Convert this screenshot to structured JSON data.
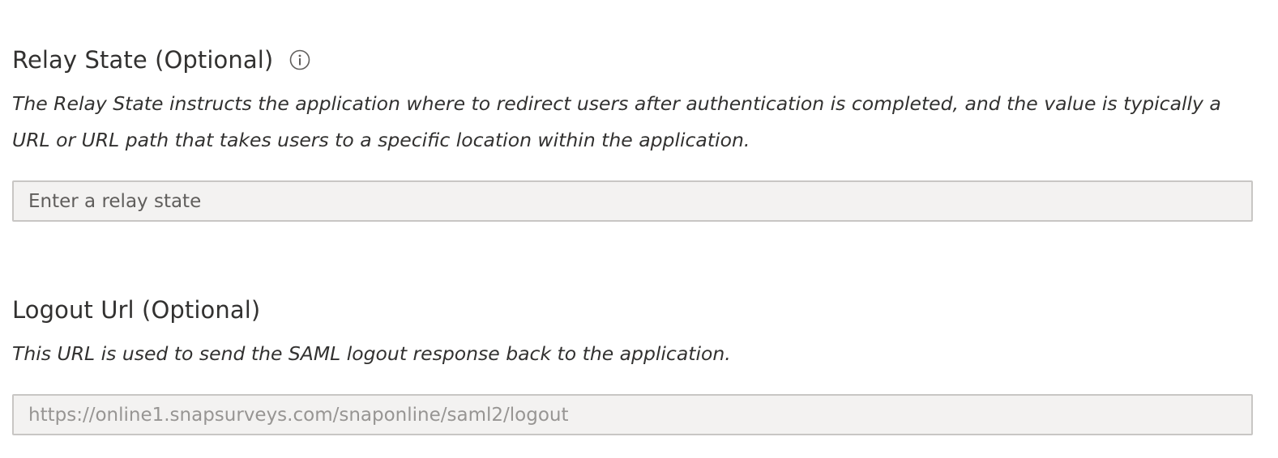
{
  "relay_state": {
    "title": "Relay State (Optional)",
    "info_icon": "info-icon",
    "description": "The Relay State instructs the application where to redirect users after authentication is completed, and the value is typically a URL or URL path that takes users to a specific location within the application.",
    "input_value": "",
    "input_placeholder": "Enter a relay state"
  },
  "logout_url": {
    "title": "Logout Url (Optional)",
    "description": "This URL is used to send the SAML logout response back to the application.",
    "input_value": "",
    "input_placeholder": "https://online1.snapsurveys.com/snaponline/saml2/logout"
  },
  "colors": {
    "text": "#323130",
    "input_background": "#f3f2f1",
    "input_border": "#c8c6c4",
    "placeholder": "#605e5c"
  }
}
